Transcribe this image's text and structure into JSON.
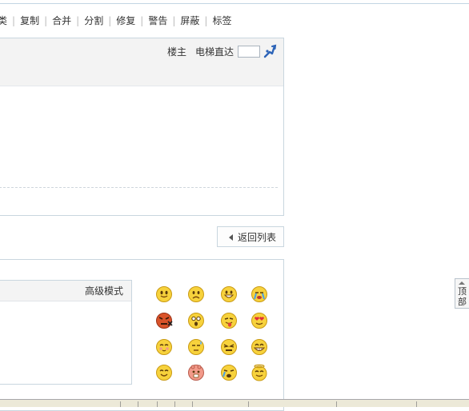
{
  "modbar": {
    "items": [
      "类",
      "复制",
      "合并",
      "分割",
      "修复",
      "警告",
      "屏蔽",
      "标签"
    ],
    "separator": "|"
  },
  "post": {
    "louzhu": "楼主",
    "jump_label": "电梯直达",
    "jump_value": ""
  },
  "return_button": "返回列表",
  "reply": {
    "advanced_mode": "高级模式"
  },
  "smilies": [
    "smile-icon",
    "sad-icon",
    "grin-icon",
    "cry-icon",
    "angry-icon",
    "shocked-icon",
    "tongue-icon",
    "love-icon",
    "shy-icon",
    "sweat-icon",
    "disgust-icon",
    "laugh-icon",
    "happy-icon",
    "dizzy-icon",
    "sob-icon",
    "angel-icon"
  ],
  "back_to_top": [
    "顶",
    "部"
  ],
  "colors": {
    "border": "#c9d6df",
    "header_bg": "#f3f3f3",
    "smiley_yellow": "#f7d23c",
    "icon_blue": "#2d64b8"
  }
}
